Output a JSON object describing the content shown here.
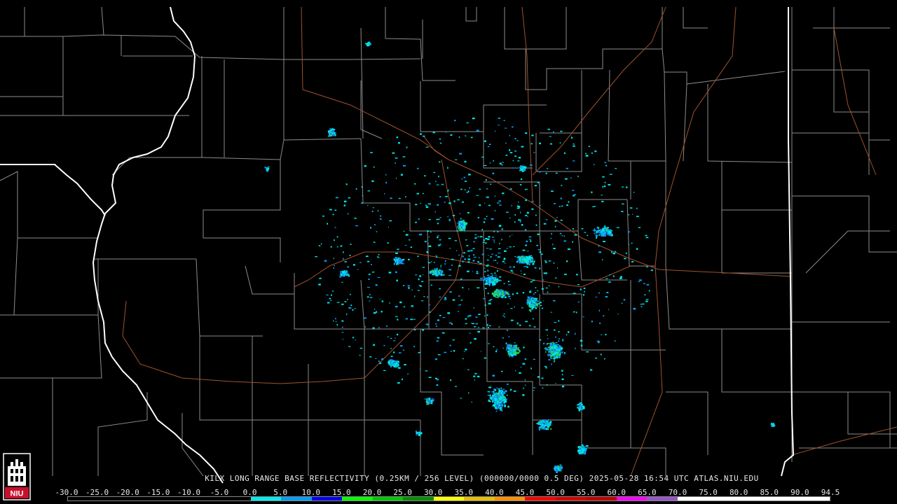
{
  "caption": {
    "text": "KILX LONG RANGE BASE REFLECTIVITY (0.25KM / 256 LEVEL) (000000/0000 0.5 DEG) 2025-05-28 16:54 UTC  ATLAS.NIU.EDU"
  },
  "scale": {
    "labels": [
      "-30.0",
      "-25.0",
      "-20.0",
      "-15.0",
      "-10.0",
      "-5.0",
      "0.0",
      "5.0",
      "10.0",
      "15.0",
      "20.0",
      "25.0",
      "30.0",
      "35.0",
      "40.0",
      "45.0",
      "50.0",
      "55.0",
      "60.0",
      "65.0",
      "70.0",
      "75.0",
      "80.0",
      "85.0",
      "90.0",
      "94.5"
    ],
    "colors": [
      "#000000",
      "#000000",
      "#000000",
      "#000000",
      "#000000",
      "#000000",
      "#00ecec",
      "#01a0f6",
      "#0000f6",
      "#00ff00",
      "#00c800",
      "#009000",
      "#ffff00",
      "#e7c000",
      "#ff9000",
      "#ff0000",
      "#d60000",
      "#c00000",
      "#ff00ff",
      "#9955c9",
      "#ffffff",
      "#ffffff",
      "#ffffff",
      "#ffffff",
      "#ffffff"
    ]
  },
  "logo": {
    "text": "NIU",
    "icon": "niu-castle-logo-icon",
    "accent": "#c8102e"
  },
  "map": {
    "background": "#000000",
    "state_border_color": "#ffffff",
    "county_border_color": "#8c8c8c",
    "highway_color": "#a0522d",
    "echo_colors": {
      "light": "#00e5e5",
      "moderate": "#0a9cf0",
      "heavy": "#1b6cf0",
      "core": "#2fd02f"
    }
  }
}
